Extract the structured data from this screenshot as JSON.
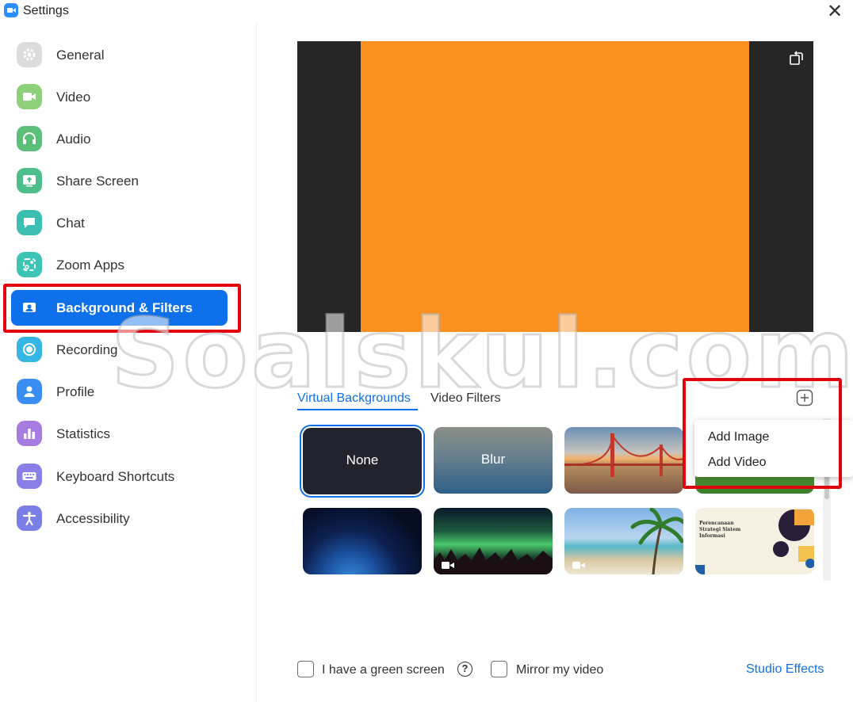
{
  "window": {
    "title": "Settings",
    "close_glyph": "✕"
  },
  "sidebar": {
    "items": [
      {
        "label": "General",
        "icon": "gear-icon",
        "color": "#dcdcdc"
      },
      {
        "label": "Video",
        "icon": "video-camera-icon",
        "color": "#8fd07a"
      },
      {
        "label": "Audio",
        "icon": "headphones-icon",
        "color": "#5bbf7a"
      },
      {
        "label": "Share Screen",
        "icon": "share-screen-icon",
        "color": "#4dbf8a"
      },
      {
        "label": "Chat",
        "icon": "chat-bubble-icon",
        "color": "#3cbfb2"
      },
      {
        "label": "Zoom Apps",
        "icon": "apps-icon",
        "color": "#3cc4b5"
      },
      {
        "label": "Background & Filters",
        "icon": "person-portrait-icon",
        "active": true
      },
      {
        "label": "Recording",
        "icon": "record-icon",
        "color": "#35b6e5"
      },
      {
        "label": "Profile",
        "icon": "person-icon",
        "color": "#3a8ef2"
      },
      {
        "label": "Statistics",
        "icon": "bar-chart-icon",
        "color": "#a67ce0"
      },
      {
        "label": "Keyboard Shortcuts",
        "icon": "keyboard-icon",
        "color": "#8a7fe6"
      },
      {
        "label": "Accessibility",
        "icon": "accessibility-icon",
        "color": "#7b7ee6"
      }
    ]
  },
  "tabs": {
    "virtual_backgrounds": "Virtual Backgrounds",
    "video_filters": "Video Filters"
  },
  "thumbnails": {
    "none": "None",
    "blur": "Blur"
  },
  "doc_thumb_text": "Perencanaan Strategi Sistem Informasi",
  "add_menu": {
    "add_image": "Add Image",
    "add_video": "Add Video"
  },
  "watermark": "Soalskul.com",
  "bottom": {
    "green_screen": "I have a green screen",
    "mirror": "Mirror my video",
    "studio_effects": "Studio Effects"
  },
  "colors": {
    "accent": "#0e71eb",
    "preview_fill": "#f9901f",
    "highlight_box": "#e3000f"
  }
}
